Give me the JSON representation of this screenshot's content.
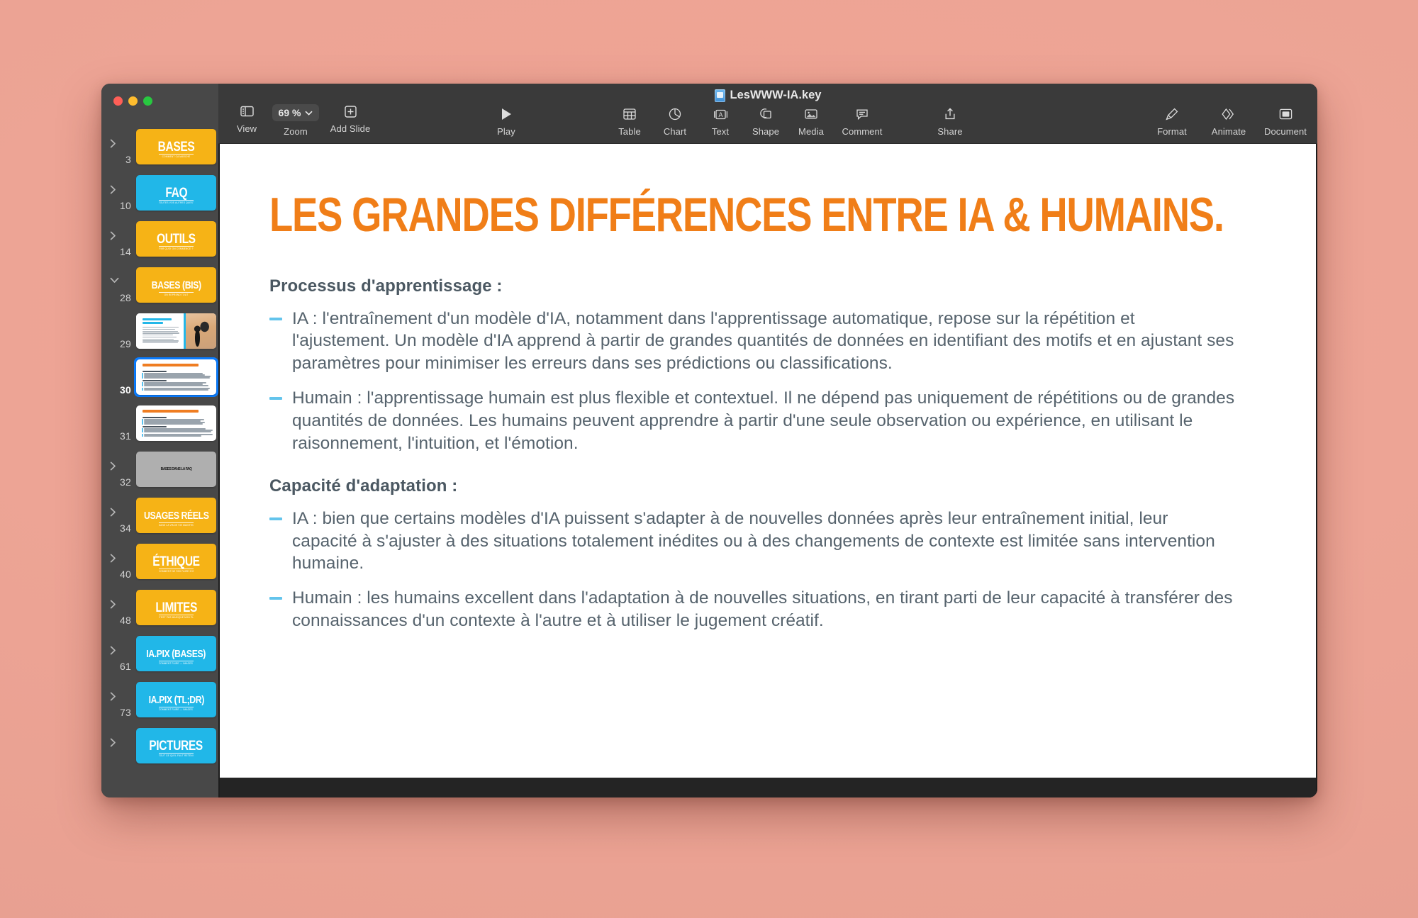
{
  "window": {
    "traffic_lights": [
      "close",
      "minimize",
      "zoom"
    ],
    "title": "LesWWW-IA.key"
  },
  "toolbar": {
    "left": [
      {
        "label": "View",
        "icon": "sidebar-view-icon"
      },
      {
        "label": "Zoom",
        "icon": "chevron-down-icon",
        "value": "69 %"
      },
      {
        "label": "Add Slide",
        "icon": "plus-square-icon"
      }
    ],
    "play": {
      "label": "Play",
      "icon": "play-icon"
    },
    "center": [
      {
        "label": "Table",
        "icon": "table-icon"
      },
      {
        "label": "Chart",
        "icon": "chart-pie-icon"
      },
      {
        "label": "Text",
        "icon": "text-box-icon"
      },
      {
        "label": "Shape",
        "icon": "shape-icon"
      },
      {
        "label": "Media",
        "icon": "media-image-icon"
      },
      {
        "label": "Comment",
        "icon": "comment-icon"
      }
    ],
    "share": {
      "label": "Share",
      "icon": "share-upload-icon"
    },
    "right": [
      {
        "label": "Format",
        "icon": "format-brush-icon"
      },
      {
        "label": "Animate",
        "icon": "animate-diamonds-icon"
      },
      {
        "label": "Document",
        "icon": "document-icon"
      }
    ]
  },
  "sidebar": {
    "slides": [
      {
        "number": "3",
        "title": "BASES",
        "subtitle": "COMMENT CA MARCHE",
        "color": "#F6B316",
        "kind": "section",
        "disclosure": "collapsed",
        "selected": false
      },
      {
        "number": "10",
        "title": "FAQ",
        "subtitle": "TOUTES VOS AUTRES QUESTIONS",
        "color": "#21B7E8",
        "kind": "section",
        "disclosure": "collapsed",
        "selected": false
      },
      {
        "number": "14",
        "title": "OUTILS",
        "subtitle": "PAR QUOI ON COMMENCE ?",
        "color": "#F6B316",
        "kind": "section",
        "disclosure": "collapsed",
        "selected": false
      },
      {
        "number": "28",
        "title": "BASES (BIS)",
        "subtitle": "ON REPREND TOUT",
        "color": "#F6B316",
        "kind": "section",
        "disclosure": "expanded",
        "selected": false
      },
      {
        "number": "29",
        "title": "",
        "subtitle": "",
        "color": "#FFFFFF",
        "kind": "photo",
        "disclosure": "none",
        "selected": false
      },
      {
        "number": "30",
        "title": "",
        "subtitle": "",
        "color": "#FFFFFF",
        "kind": "doc",
        "disclosure": "none",
        "selected": true
      },
      {
        "number": "31",
        "title": "",
        "subtitle": "",
        "color": "#FFFFFF",
        "kind": "doc",
        "disclosure": "none",
        "selected": false
      },
      {
        "number": "32",
        "title": "BASES DANS LA FAQ",
        "subtitle": "",
        "color": "#AFAFAF",
        "kind": "grey",
        "disclosure": "collapsed",
        "selected": false
      },
      {
        "number": "34",
        "title": "USAGES RÉELS",
        "subtitle": "DANS LA VRAIE VIE MAINTENANT",
        "color": "#F6B316",
        "kind": "section",
        "disclosure": "collapsed",
        "selected": false
      },
      {
        "number": "40",
        "title": "ÉTHIQUE",
        "subtitle": "COMMENT NE PAS FAIRE N'IMPORTE QUOI",
        "color": "#F6B316",
        "kind": "section",
        "disclosure": "collapsed",
        "selected": false
      },
      {
        "number": "48",
        "title": "LIMITES",
        "subtitle": "C'EST PAS MAGIQUE NON PLUS",
        "color": "#F6B316",
        "kind": "section",
        "disclosure": "collapsed",
        "selected": false
      },
      {
        "number": "61",
        "title": "IA.PIX (BASES)",
        "subtitle": "COMMENT FAIRE — IMAGES GÉNÉRATIVES, BASES",
        "color": "#21B7E8",
        "kind": "section",
        "disclosure": "collapsed",
        "selected": false
      },
      {
        "number": "73",
        "title": "IA.PIX (TL;DR)",
        "subtitle": "COMMENT FAIRE — IMAGES GÉNÉRATIVES, RÉSUMÉ",
        "color": "#21B7E8",
        "kind": "section",
        "disclosure": "collapsed",
        "selected": false
      },
      {
        "number": "",
        "title": "PICTURES",
        "subtitle": "TOUT CE QU'IL FAUT RETENIR EN IMAGES",
        "color": "#21B7E8",
        "kind": "section",
        "disclosure": "collapsed",
        "selected": false
      }
    ]
  },
  "slide": {
    "title": "LES GRANDES DIFFÉRENCES ENTRE IA & HUMAINS.",
    "title_color": "#F07E18",
    "bullet_color": "#63C4EC",
    "text_color": "#56636D",
    "sections": [
      {
        "heading": "Processus d'apprentissage :",
        "bullets": [
          "IA : l'entraînement d'un modèle d'IA, notamment dans l'apprentissage automatique, repose sur la répétition et l'ajustement. Un modèle d'IA apprend à partir de grandes quantités de données en identifiant des motifs et en ajustant ses paramètres pour minimiser les erreurs dans ses prédictions ou classifications.",
          "Humain : l'apprentissage humain est plus flexible et contextuel. Il ne dépend pas uniquement de répétitions ou de grandes quantités de données. Les humains peuvent apprendre à partir d'une seule observation ou expérience, en utilisant le raisonnement, l'intuition, et l'émotion."
        ]
      },
      {
        "heading": "Capacité d'adaptation :",
        "bullets": [
          "IA : bien que certains modèles d'IA puissent s'adapter à de nouvelles données après leur entraînement initial, leur capacité à s'ajuster à des situations totalement inédites ou à des changements de contexte est limitée sans intervention humaine.",
          "Humain : les humains excellent dans l'adaptation à de nouvelles situations, en tirant parti de leur capacité à transférer des connaissances d'un contexte à l'autre et à utiliser le jugement créatif."
        ]
      }
    ]
  }
}
